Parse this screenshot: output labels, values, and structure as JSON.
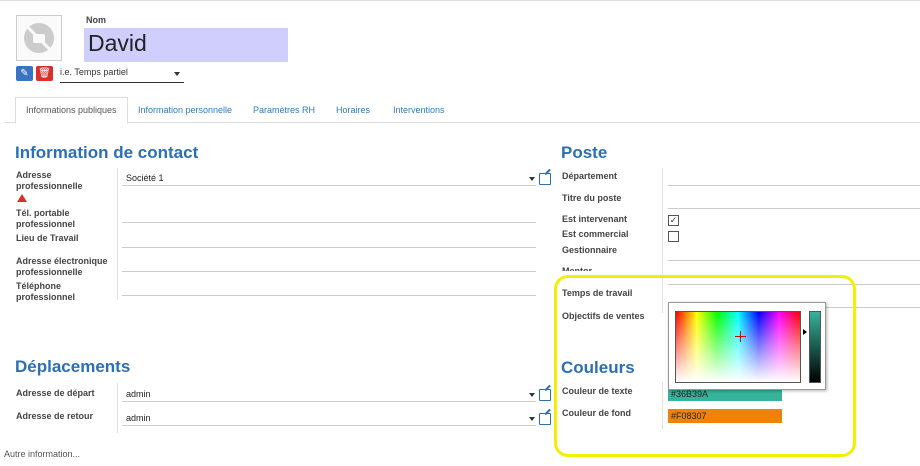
{
  "header": {
    "nom_label": "Nom",
    "name_value": "David",
    "type_select_value": "i.e. Temps partiel"
  },
  "tabs": [
    {
      "label": "Informations publiques",
      "active": true
    },
    {
      "label": "Information personnelle"
    },
    {
      "label": "Paramètres RH"
    },
    {
      "label": "Horaires"
    },
    {
      "label": "Interventions"
    }
  ],
  "contact": {
    "title": "Information de contact",
    "adresse_label": "Adresse professionnelle",
    "adresse_value": "Société 1",
    "tel_label": "Tél. portable professionnel",
    "lieu_label": "Lieu de Travail",
    "email_label": "Adresse électronique professionnelle",
    "phone_label": "Téléphone professionnel"
  },
  "deplacements": {
    "title": "Déplacements",
    "depart_label": "Adresse de départ",
    "depart_value": "admin",
    "retour_label": "Adresse de retour",
    "retour_value": "admin"
  },
  "poste": {
    "title": "Poste",
    "departement_label": "Département",
    "titre_label": "Titre du poste",
    "intervenant_label": "Est intervenant",
    "intervenant_checked": true,
    "commercial_label": "Est commercial",
    "commercial_checked": false,
    "gestionnaire_label": "Gestionnaire",
    "hidden_label": "Mentor",
    "temps_label": "Temps de travail",
    "objectifs_label": "Objectifs de ventes"
  },
  "couleurs": {
    "title": "Couleurs",
    "texte_label": "Couleur de texte",
    "texte_value": "#36B39A",
    "fond_label": "Couleur de fond",
    "fond_value": "#F08307"
  },
  "footer": {
    "autre": "Autre information..."
  },
  "colors": {
    "accent": "#2c6fb3",
    "name_bg": "#cfcefc",
    "highlight": "#f4ef00"
  },
  "icons": {
    "photo": "no-photo-icon",
    "edit": "pencil-icon",
    "delete": "trash-icon",
    "external": "external-link-icon",
    "warning": "warning-icon"
  }
}
